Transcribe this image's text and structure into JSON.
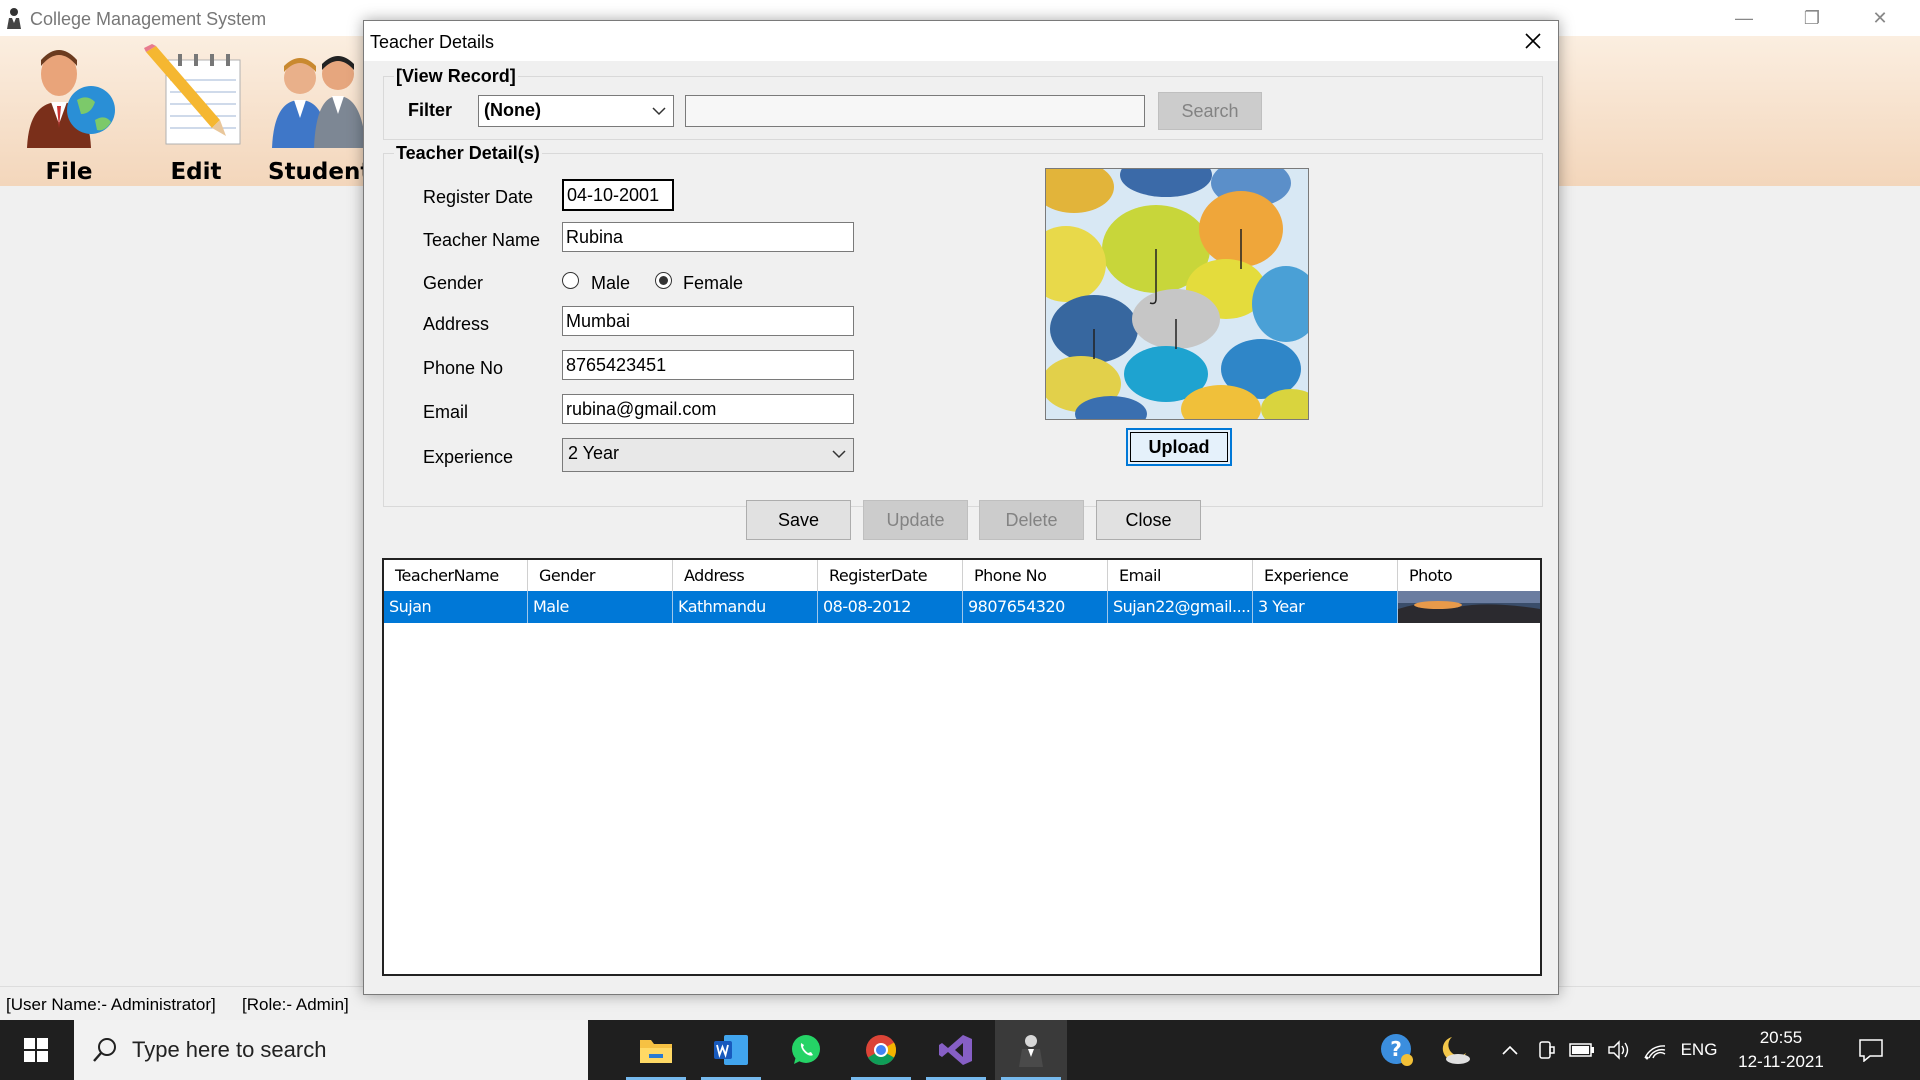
{
  "app": {
    "title": "College Management System",
    "window_controls": {
      "minimize": "—",
      "restore": "❐",
      "close": "✕"
    }
  },
  "toolbar": {
    "items": [
      {
        "label": "File",
        "icon": "teacher-globe-icon"
      },
      {
        "label": "Edit",
        "icon": "notepad-pencil-icon"
      },
      {
        "label": "Student",
        "icon": "students-icon"
      }
    ]
  },
  "dialog": {
    "title": "Teacher Details",
    "view_record": {
      "group_label": "[View Record]",
      "filter_label": "Filter",
      "filter_value": "(None)",
      "search_value": "",
      "search_button": "Search"
    },
    "teacher_details": {
      "group_label": "Teacher Detail(s)",
      "register_date_label": "Register Date",
      "register_date": "04-10-2001",
      "teacher_name_label": "Teacher Name",
      "teacher_name": "Rubina",
      "gender_label": "Gender",
      "gender_options": [
        "Male",
        "Female"
      ],
      "gender_selected": "Female",
      "address_label": "Address",
      "address": "Mumbai",
      "phone_label": "Phone No",
      "phone": "8765423451",
      "email_label": "Email",
      "email": "rubina@gmail.com",
      "experience_label": "Experience",
      "experience": "2 Year",
      "photo_icon": "umbrellas-photo",
      "upload_button": "Upload"
    },
    "actions": {
      "save": "Save",
      "update": "Update",
      "delete": "Delete",
      "close": "Close"
    },
    "grid": {
      "columns": [
        "TeacherName",
        "Gender",
        "Address",
        "RegisterDate",
        "Phone No",
        "Email",
        "Experience",
        "Photo"
      ],
      "rows": [
        {
          "TeacherName": "Sujan",
          "Gender": "Male",
          "Address": "Kathmandu",
          "RegisterDate": "08-08-2012",
          "PhoneNo": "9807654320",
          "Email": "Sujan22@gmail....",
          "Experience": "3 Year",
          "Photo": "landscape-thumbnail",
          "selected": true
        }
      ]
    }
  },
  "status": {
    "user": "[User Name:- Administrator]",
    "role": "[Role:- Admin]"
  },
  "taskbar": {
    "search_placeholder": "Type here to search",
    "apps": [
      "file-explorer",
      "word",
      "whatsapp",
      "chrome",
      "visual-studio",
      "college-management-app"
    ],
    "tray": {
      "language": "ENG",
      "time": "20:55",
      "date": "12-11-2021"
    }
  },
  "colors": {
    "selection": "#0078d7",
    "toolbar_top": "#fbeee0",
    "toolbar_bottom": "#f3d6bb",
    "taskbar": "#1f1f1f"
  }
}
